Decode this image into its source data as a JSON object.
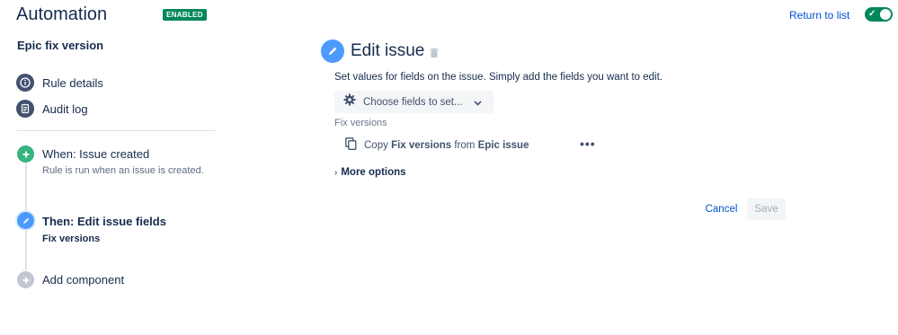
{
  "header": {
    "title": "Automation",
    "status_badge": "ENABLED",
    "return_link": "Return to list",
    "toggle_on": true
  },
  "sidebar": {
    "rule_name": "Epic fix version",
    "items": [
      {
        "label": "Rule details",
        "icon": "info-icon"
      },
      {
        "label": "Audit log",
        "icon": "document-icon"
      }
    ],
    "steps": [
      {
        "title": "When: Issue created",
        "subtitle": "Rule is run when an issue is created.",
        "icon": "plus-icon",
        "color": "#36b37e"
      },
      {
        "title": "Then: Edit issue fields",
        "subtitle": "Fix versions",
        "icon": "pencil-icon",
        "color": "#4c9aff"
      },
      {
        "title": "Add component",
        "icon": "plus-icon",
        "color": "#c1c7d0"
      }
    ]
  },
  "main": {
    "title": "Edit issue",
    "description": "Set values for fields on the issue. Simply add the fields you want to edit.",
    "choose_fields": "Choose fields to set...",
    "field_label": "Fix versions",
    "copy_row": {
      "prefix": "Copy",
      "field": "Fix versions",
      "middle": "from",
      "source": "Epic issue"
    },
    "more_options": "More options",
    "cancel": "Cancel",
    "save": "Save"
  },
  "colors": {
    "accent": "#0052cc",
    "success": "#00875a",
    "edit_blue": "#4c9aff",
    "trigger_green": "#36b37e"
  }
}
